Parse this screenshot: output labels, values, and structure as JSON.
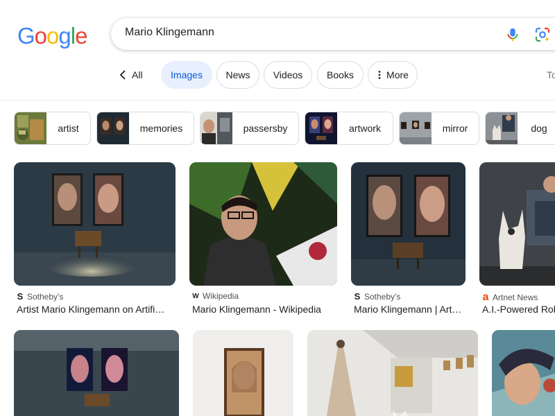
{
  "logo": {
    "letters": [
      "G",
      "o",
      "o",
      "g",
      "l",
      "e"
    ],
    "colors": [
      "#4285F4",
      "#EA4335",
      "#FBBC05",
      "#4285F4",
      "#34A853",
      "#EA4335"
    ]
  },
  "search": {
    "query": "Mario Klingemann"
  },
  "tabs": {
    "all": "All",
    "items": [
      "Images",
      "News",
      "Videos",
      "Books",
      "More"
    ],
    "tools": "To"
  },
  "refinements": [
    "artist",
    "memories",
    "passersby",
    "artwork",
    "mirror",
    "dog"
  ],
  "results": [
    {
      "source": "Sotheby's",
      "favicon": "S",
      "title": "Artist Mario Klingemann on Artifi…"
    },
    {
      "source": "Wikipedia",
      "favicon": "W",
      "title": "Mario Klingemann - Wikipedia"
    },
    {
      "source": "Sotheby's",
      "favicon": "S",
      "title": "Mario Klingemann | Art…"
    },
    {
      "source": "Artnet News",
      "favicon": "a",
      "title": "A.I.-Powered Rob"
    }
  ],
  "colors": {
    "accent": "#0b57d0",
    "active_chip_bg": "#e8f0fe",
    "artnet": "#e8490f"
  }
}
